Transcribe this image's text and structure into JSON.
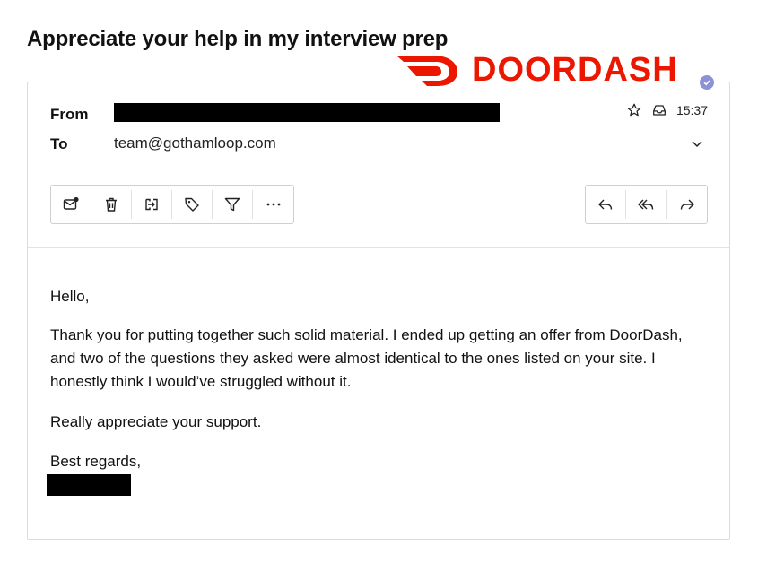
{
  "email": {
    "subject": "Appreciate your help in my interview prep",
    "brand": {
      "wordmark": "DOORDASH",
      "color": "#eb1700",
      "verified_badge_color": "#8b93d6"
    },
    "header": {
      "from_label": "From",
      "from_value": "",
      "to_label": "To",
      "to_value": "team@gothamloop.com",
      "time": "15:37"
    },
    "toolbar_left": [
      {
        "name": "mark-unread",
        "icon": "mail-dot-icon"
      },
      {
        "name": "delete",
        "icon": "trash-icon"
      },
      {
        "name": "move",
        "icon": "move-to-folder-icon"
      },
      {
        "name": "tag",
        "icon": "tag-icon"
      },
      {
        "name": "filter",
        "icon": "filter-icon"
      },
      {
        "name": "more",
        "icon": "more-icon"
      }
    ],
    "toolbar_right": [
      {
        "name": "reply",
        "icon": "reply-icon"
      },
      {
        "name": "reply-all",
        "icon": "reply-all-icon"
      },
      {
        "name": "forward",
        "icon": "forward-icon"
      }
    ],
    "body": {
      "greeting": "Hello,",
      "paragraph1": "Thank you for putting together such solid material. I ended up getting an offer from DoorDash, and two of the questions they asked were almost identical to the ones listed on your site. I honestly think I would’ve struggled without it.",
      "paragraph2": "Really appreciate your support.",
      "signoff": "Best regards,"
    }
  }
}
